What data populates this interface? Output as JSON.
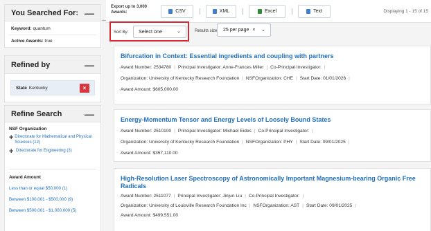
{
  "sidebar": {
    "searched": {
      "title": "You Searched For:",
      "keyword_label": "Keyword:",
      "keyword_value": "quantum",
      "active_label": "Active Awards:",
      "active_value": "true"
    },
    "refined": {
      "title": "Refined by",
      "chip_label": "State",
      "chip_value": "Kentucky",
      "remove": "×"
    },
    "refine": {
      "title": "Refine Search",
      "org_heading": "NSF Organization",
      "orgs": [
        {
          "plus": "+",
          "label": "Directorate for Mathematical and Physical Sciences (12)"
        },
        {
          "plus": "+",
          "label": "Directorate for Engineering (3)"
        }
      ],
      "amount_heading": "Award Amount",
      "amounts": [
        "Less than or equal $50,000 (1)",
        "Between $100,001 - $500,000 (9)",
        "Between $500,001 - $1,000,000 (5)"
      ]
    },
    "dash": "—",
    "collapse_arrow": "←"
  },
  "toolbar": {
    "export_label": "Export up to 3,000 Awards:",
    "buttons": [
      "CSV",
      "XML",
      "Excel",
      "Text"
    ],
    "pipe": "|",
    "displaying": "Displaying 1 - 15 of 15"
  },
  "controls": {
    "sort_label": "Sort By:",
    "sort_value": "Select one",
    "size_label": "Results size:",
    "size_value": "25 per page",
    "size_clear": "×",
    "chevron": "⌄"
  },
  "results": [
    {
      "title": "Bifurcation in Context: Essential ingredients and coupling with partners",
      "award_number": "Award Number: 2534780",
      "pi": "Principal Investigator: Anne-Frances Miller",
      "co_pi": "Co-Principal Investigator:",
      "org": "Organization: University of Kentucky Research Foundation",
      "nsf_org": "NSFOrganization: CHE",
      "start": "Start Date: 01/01/2026",
      "amount": "Award Amount: $605,000.00"
    },
    {
      "title": "Energy-Momentum Tensor and Energy Levels of Loosely Bound States",
      "award_number": "Award Number: 2510100",
      "pi": "Principal Investigator: Michael Eides",
      "co_pi": "Co-Principal Investigator:",
      "org": "Organization: University of Kentucky Research Foundation",
      "nsf_org": "NSFOrganization: PHY",
      "start": "Start Date: 09/01/2025",
      "amount": "Award Amount: $357,110.00"
    },
    {
      "title": "High-Resolution Laser Spectroscopy of Astronomically Important Magnesium-bearing Organic Free Radicals",
      "award_number": "Award Number: 2511077",
      "pi": "Principal Investigator: Jinjun Liu",
      "co_pi": "Co-Principal Investigator:",
      "org": "Organization: University of Louisville Research Foundation Inc",
      "nsf_org": "NSFOrganization: AST",
      "start": "Start Date: 09/01/2025",
      "amount": "Award Amount: $499,551.00"
    }
  ],
  "colors": {
    "link": "#1f6ebf",
    "remove_button": "#d9363e",
    "highlight_border": "#d6262f",
    "csv_icon": "#3f7fd0",
    "xml_icon": "#3f7fd0",
    "excel_icon": "#2f8a3e",
    "text_icon": "#3f7fd0"
  }
}
